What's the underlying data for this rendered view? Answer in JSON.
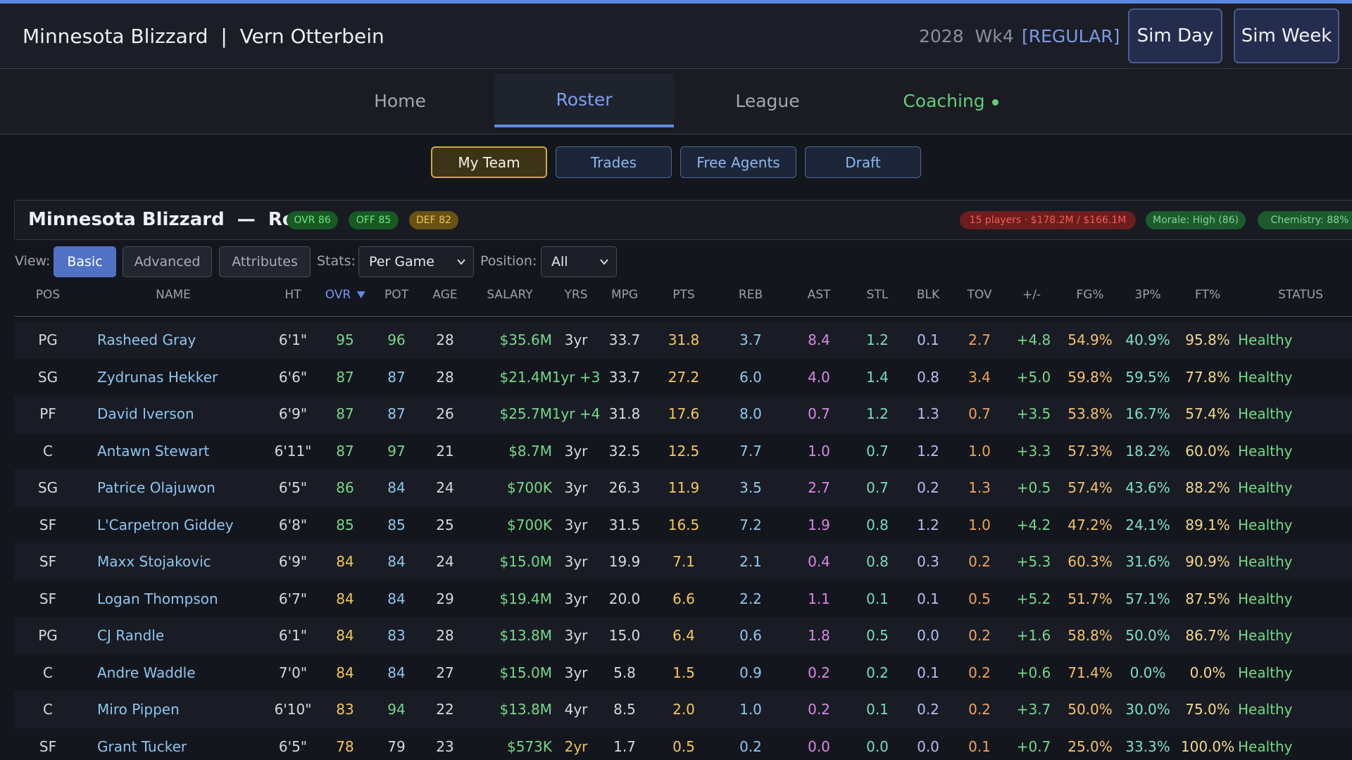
{
  "header": {
    "team": "Minnesota Blizzard",
    "separator": "|",
    "gm": "Vern Otterbein",
    "season": "2028",
    "week": "Wk4",
    "phase": "[REGULAR]",
    "sim_day": "Sim Day",
    "sim_week": "Sim Week"
  },
  "nav": [
    "Home",
    "Roster",
    "League",
    "Coaching"
  ],
  "subtabs": [
    "My Team",
    "Trades",
    "Free Agents",
    "Draft"
  ],
  "roster": {
    "team": "Minnesota Blizzard",
    "dash": "—",
    "label": "Roster",
    "ovr": "OVR 86",
    "off": "OFF 85",
    "def": "DEF 82",
    "cap": "15 players · $178.2M / $166.1M",
    "morale": "Morale: High (86)",
    "chemistry": "Chemistry: 88%"
  },
  "controls": {
    "view_label": "View:",
    "views": [
      "Basic",
      "Advanced",
      "Attributes"
    ],
    "stats_label": "Stats:",
    "stats_value": "Per Game",
    "position_label": "Position:",
    "position_value": "All"
  },
  "columns": [
    "POS",
    "NAME",
    "HT",
    "OVR",
    "POT",
    "AGE",
    "SALARY",
    "YRS",
    "MPG",
    "PTS",
    "REB",
    "AST",
    "STL",
    "BLK",
    "TOV",
    "+/-",
    "FG%",
    "3P%",
    "FT%",
    "STATUS"
  ],
  "colors": {
    "ovr_high": "#74d98a",
    "ovr_mid": "#f5c85a",
    "pot_high": "#74d98a",
    "pot_blue": "#8ec8ef",
    "pot_plain": "#d6d9e0"
  },
  "players": [
    {
      "pos": "PG",
      "name": "Rasheed Gray",
      "ht": "6'1\"",
      "ovr": "95",
      "pot": "96",
      "age": "28",
      "salary": "$35.6M",
      "yrs": "3yr",
      "mpg": "33.7",
      "pts": "31.8",
      "reb": "3.7",
      "ast": "8.4",
      "stl": "1.2",
      "blk": "0.1",
      "tov": "2.7",
      "pm": "+4.8",
      "fg": "54.9%",
      "tp": "40.9%",
      "ft": "95.8%",
      "status": "Healthy"
    },
    {
      "pos": "SG",
      "name": "Zydrunas Hekker",
      "ht": "6'6\"",
      "ovr": "87",
      "pot": "87",
      "age": "28",
      "salary": "$21.4M",
      "yrs": "1yr +3",
      "mpg": "33.7",
      "pts": "27.2",
      "reb": "6.0",
      "ast": "4.0",
      "stl": "1.4",
      "blk": "0.8",
      "tov": "3.4",
      "pm": "+5.0",
      "fg": "59.8%",
      "tp": "59.5%",
      "ft": "77.8%",
      "status": "Healthy"
    },
    {
      "pos": "PF",
      "name": "David Iverson",
      "ht": "6'9\"",
      "ovr": "87",
      "pot": "87",
      "age": "26",
      "salary": "$25.7M",
      "yrs": "1yr +4",
      "mpg": "31.8",
      "pts": "17.6",
      "reb": "8.0",
      "ast": "0.7",
      "stl": "1.2",
      "blk": "1.3",
      "tov": "0.7",
      "pm": "+3.5",
      "fg": "53.8%",
      "tp": "16.7%",
      "ft": "57.4%",
      "status": "Healthy"
    },
    {
      "pos": "C",
      "name": "Antawn Stewart",
      "ht": "6'11\"",
      "ovr": "87",
      "pot": "97",
      "age": "21",
      "salary": "$8.7M",
      "yrs": "3yr",
      "mpg": "32.5",
      "pts": "12.5",
      "reb": "7.7",
      "ast": "1.0",
      "stl": "0.7",
      "blk": "1.2",
      "tov": "1.0",
      "pm": "+3.3",
      "fg": "57.3%",
      "tp": "18.2%",
      "ft": "60.0%",
      "status": "Healthy"
    },
    {
      "pos": "SG",
      "name": "Patrice Olajuwon",
      "ht": "6'5\"",
      "ovr": "86",
      "pot": "84",
      "age": "24",
      "salary": "$700K",
      "yrs": "3yr",
      "mpg": "26.3",
      "pts": "11.9",
      "reb": "3.5",
      "ast": "2.7",
      "stl": "0.7",
      "blk": "0.2",
      "tov": "1.3",
      "pm": "+0.5",
      "fg": "57.4%",
      "tp": "43.6%",
      "ft": "88.2%",
      "status": "Healthy"
    },
    {
      "pos": "SF",
      "name": "L'Carpetron Giddey",
      "ht": "6'8\"",
      "ovr": "85",
      "pot": "85",
      "age": "25",
      "salary": "$700K",
      "yrs": "3yr",
      "mpg": "31.5",
      "pts": "16.5",
      "reb": "7.2",
      "ast": "1.9",
      "stl": "0.8",
      "blk": "1.2",
      "tov": "1.0",
      "pm": "+4.2",
      "fg": "47.2%",
      "tp": "24.1%",
      "ft": "89.1%",
      "status": "Healthy"
    },
    {
      "pos": "SF",
      "name": "Maxx Stojakovic",
      "ht": "6'9\"",
      "ovr": "84",
      "pot": "84",
      "age": "24",
      "salary": "$15.0M",
      "yrs": "3yr",
      "mpg": "19.9",
      "pts": "7.1",
      "reb": "2.1",
      "ast": "0.4",
      "stl": "0.8",
      "blk": "0.3",
      "tov": "0.2",
      "pm": "+5.3",
      "fg": "60.3%",
      "tp": "31.6%",
      "ft": "90.9%",
      "status": "Healthy"
    },
    {
      "pos": "SF",
      "name": "Logan Thompson",
      "ht": "6'7\"",
      "ovr": "84",
      "pot": "84",
      "age": "29",
      "salary": "$19.4M",
      "yrs": "3yr",
      "mpg": "20.0",
      "pts": "6.6",
      "reb": "2.2",
      "ast": "1.1",
      "stl": "0.1",
      "blk": "0.1",
      "tov": "0.5",
      "pm": "+5.2",
      "fg": "51.7%",
      "tp": "57.1%",
      "ft": "87.5%",
      "status": "Healthy"
    },
    {
      "pos": "PG",
      "name": "CJ Randle",
      "ht": "6'1\"",
      "ovr": "84",
      "pot": "83",
      "age": "28",
      "salary": "$13.8M",
      "yrs": "3yr",
      "mpg": "15.0",
      "pts": "6.4",
      "reb": "0.6",
      "ast": "1.8",
      "stl": "0.5",
      "blk": "0.0",
      "tov": "0.2",
      "pm": "+1.6",
      "fg": "58.8%",
      "tp": "50.0%",
      "ft": "86.7%",
      "status": "Healthy"
    },
    {
      "pos": "C",
      "name": "Andre Waddle",
      "ht": "7'0\"",
      "ovr": "84",
      "pot": "84",
      "age": "27",
      "salary": "$15.0M",
      "yrs": "3yr",
      "mpg": "5.8",
      "pts": "1.5",
      "reb": "0.9",
      "ast": "0.2",
      "stl": "0.2",
      "blk": "0.1",
      "tov": "0.2",
      "pm": "+0.6",
      "fg": "71.4%",
      "tp": "0.0%",
      "ft": "0.0%",
      "status": "Healthy"
    },
    {
      "pos": "C",
      "name": "Miro Pippen",
      "ht": "6'10\"",
      "ovr": "83",
      "pot": "94",
      "age": "22",
      "salary": "$13.8M",
      "yrs": "4yr",
      "mpg": "8.5",
      "pts": "2.0",
      "reb": "1.0",
      "ast": "0.2",
      "stl": "0.1",
      "blk": "0.2",
      "tov": "0.2",
      "pm": "+3.7",
      "fg": "50.0%",
      "tp": "30.0%",
      "ft": "75.0%",
      "status": "Healthy"
    },
    {
      "pos": "SF",
      "name": "Grant Tucker",
      "ht": "6'5\"",
      "ovr": "78",
      "pot": "79",
      "age": "23",
      "salary": "$573K",
      "yrs": "2yr",
      "mpg": "1.7",
      "pts": "0.5",
      "reb": "0.2",
      "ast": "0.0",
      "stl": "0.0",
      "blk": "0.0",
      "tov": "0.1",
      "pm": "+0.7",
      "fg": "25.0%",
      "tp": "33.3%",
      "ft": "100.0%",
      "status": "Healthy"
    }
  ]
}
